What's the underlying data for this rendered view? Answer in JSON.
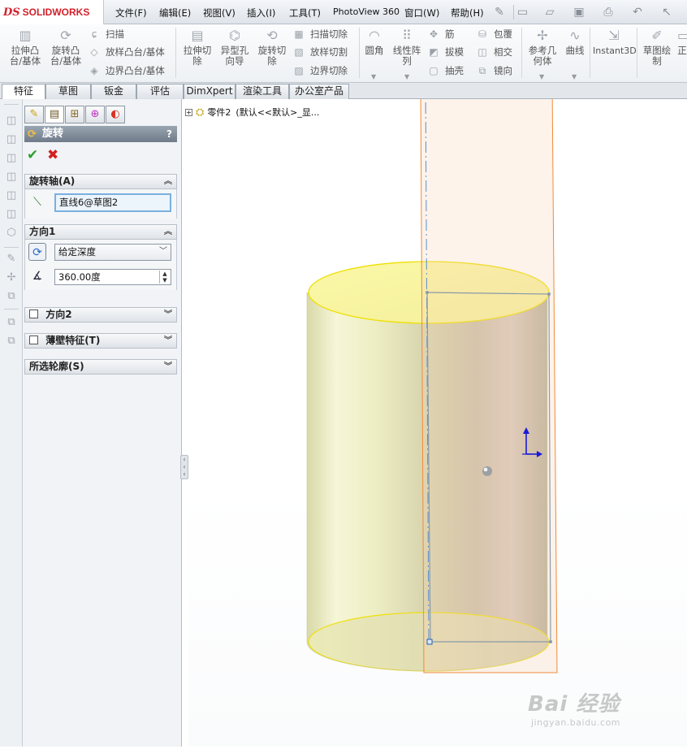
{
  "app": {
    "logo_ds": "DS",
    "logo_name": "SOLIDWORKS"
  },
  "menu": [
    "文件(F)",
    "编辑(E)",
    "视图(V)",
    "插入(I)",
    "工具(T)",
    "PhotoView 360",
    "窗口(W)",
    "帮助(H)"
  ],
  "ribbon": {
    "extrude_boss": "拉伸凸台/基体",
    "revolve_boss": "旋转凸台/基体",
    "sweep": "扫描",
    "loft_boss": "放样凸台/基体",
    "boundary_boss": "边界凸台/基体",
    "extrude_cut": "拉伸切除",
    "hole_wizard": "异型孔向导",
    "revolve_cut": "旋转切除",
    "sweep_cut": "扫描切除",
    "loft_cut": "放样切割",
    "boundary_cut": "边界切除",
    "fillet": "圆角",
    "linear_pattern": "线性阵列",
    "rib": "筋",
    "draft": "拔模",
    "shell": "抽壳",
    "wrap": "包覆",
    "intersect": "相交",
    "mirror": "镜向",
    "ref_geometry": "参考几何体",
    "curves": "曲线",
    "instant3d": "Instant3D",
    "sketch": "草图绘制",
    "cut_off": "正"
  },
  "tabs": [
    "特征",
    "草图",
    "钣金",
    "评估",
    "DimXpert",
    "渲染工具",
    "办公室产品"
  ],
  "pm": {
    "title": "旋转",
    "help": "?",
    "ok": "✔",
    "cancel": "✖",
    "axis_group": "旋转轴(A)",
    "axis_value": "直线6@草图2",
    "dir1_group": "方向1",
    "end_condition": "给定深度",
    "angle_value": "360.00度",
    "dir2_group": "方向2",
    "thin_group": "薄壁特征(T)",
    "contours_group": "所选轮廓(S)"
  },
  "tree": {
    "part": "零件2",
    "config": "(默认<<默认>_显..."
  },
  "watermark": {
    "main": "Bai 经验",
    "sub": "jingyan.baidu.com"
  },
  "colors": {
    "cylinder": "#eeeec8",
    "edge": "#f0e000",
    "preview": "#f6b98a",
    "accent": "#d2202a"
  }
}
